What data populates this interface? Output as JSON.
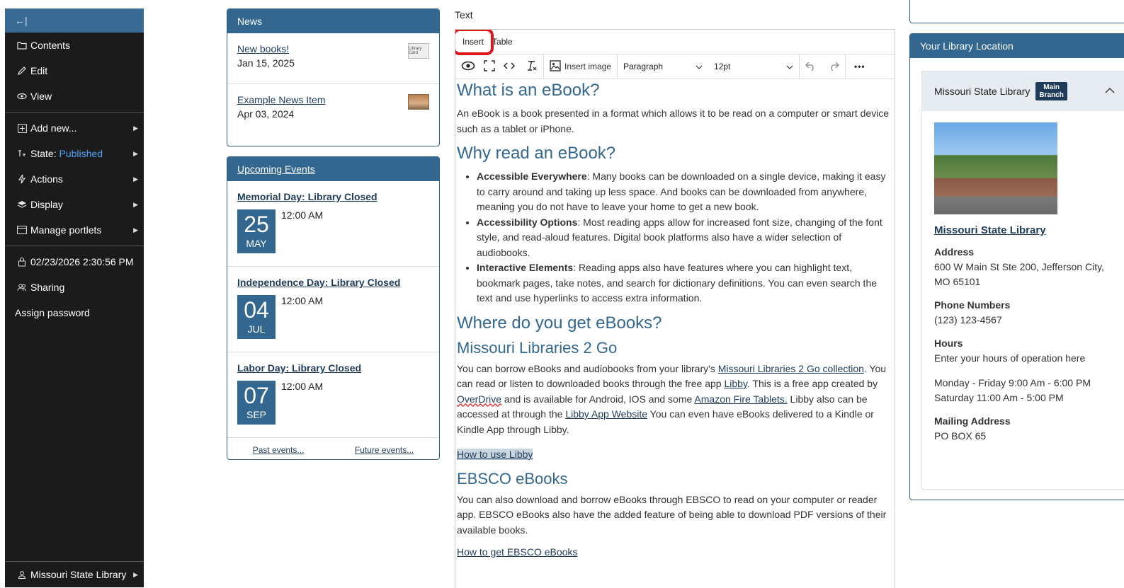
{
  "toolbar": {
    "collapse_icon": "←|",
    "items": [
      {
        "label": "Contents"
      },
      {
        "label": "Edit"
      },
      {
        "label": "View"
      },
      {
        "label": "Add new..."
      },
      {
        "label_prefix": "State:",
        "label_value": "Published"
      },
      {
        "label": "Actions"
      },
      {
        "label": "Display"
      },
      {
        "label": "Manage portlets"
      },
      {
        "label": "02/23/2026 2:30:56 PM"
      },
      {
        "label": "Sharing"
      },
      {
        "label": "Assign password"
      }
    ],
    "user": "Missouri State Library",
    "colors": {
      "accent": "#4ea3ff",
      "bg": "#1b1b1b",
      "header": "#3a6b94"
    }
  },
  "news": {
    "header": "News",
    "items": [
      {
        "title": "New books!",
        "date": "Jan 15, 2025",
        "thumb": "Library Card"
      },
      {
        "title": "Example News Item",
        "date": "Apr 03, 2024"
      }
    ]
  },
  "events": {
    "header": "Upcoming Events",
    "items": [
      {
        "title": "Memorial Day: Library Closed",
        "day": "25",
        "month": "MAY",
        "time": "12:00 AM"
      },
      {
        "title": "Independence Day: Library Closed",
        "day": "04",
        "month": "JUL",
        "time": "12:00 AM"
      },
      {
        "title": "Labor Day: Library Closed",
        "day": "07",
        "month": "SEP",
        "time": "12:00 AM"
      }
    ],
    "past": "Past events...",
    "future": "Future events..."
  },
  "editor": {
    "field_label": "Text",
    "menu": {
      "insert": "Insert",
      "table": "Table"
    },
    "toolbar": {
      "insert_image": "Insert image",
      "block_format": "Paragraph",
      "font_size": "12pt",
      "more": "•••"
    },
    "content": {
      "h1": "What is an eBook?",
      "p1": "An eBook is a book presented in a format which allows it to be read on a computer or smart device such as a tablet or iPhone.",
      "h2": "Why read an eBook?",
      "bullets": [
        {
          "bold": "Accessible Everywhere",
          "text": ": Many books can be downloaded on a single device, making it easy to carry around and taking up less space. And books can be downloaded from anywhere, meaning you do not have to leave your home to get a new book."
        },
        {
          "bold": "Accessibility Options",
          "text": ": Most reading apps allow for increased font size, changing of the font style, and read-aloud features. Digital book platforms also have a wider selection of audiobooks."
        },
        {
          "bold": "Interactive Elements",
          "text": ": Reading apps also have features where you can highlight text, bookmark pages, take notes, and search for dictionary definitions. You can even search the text and use hyperlinks to access extra information."
        }
      ],
      "h3": "Where do you get eBooks?",
      "h4": "Missouri Libraries 2 Go",
      "p2_a": "You can borrow eBooks and audiobooks from your library's ",
      "p2_link1": "Missouri Libraries 2 Go collection",
      "p2_b": ". You can read or listen to downloaded books through the free app ",
      "p2_link2": "Libby",
      "p2_c": ". This is a free app created by ",
      "p2_link3": "OverDrive",
      "p2_d": " and is available for Android, IOS and some ",
      "p2_link4": "Amazon Fire Tablets.",
      "p2_e": " Libby also can be accessed at through the ",
      "p2_link5": "Libby App Website",
      "p2_f": " You can even have eBooks delivered to a Kindle or Kindle App through Libby.",
      "libby_link": "How to use Libby",
      "h5": "EBSCO eBooks",
      "p3": "You can also download and borrow eBooks through EBSCO to read on your computer or reader app. EBSCO eBooks also have the added feature of being able to download PDF versions of their available books.",
      "ebsco_link": "How to get EBSCO eBooks"
    }
  },
  "location": {
    "header": "Your Library Location",
    "card_title": "Missouri State Library",
    "badge_line1": "Main",
    "badge_line2": "Branch",
    "name": "Missouri State Library",
    "address_label": "Address",
    "address": "600 W Main St Ste 200, Jefferson City, MO 65101",
    "phone_label": "Phone Numbers",
    "phone": "(123) 123-4567",
    "hours_label": "Hours",
    "hours_note": "Enter your hours of operation here",
    "hours_1": "Monday - Friday 9:00 Am - 6:00 PM",
    "hours_2": "Saturday 11:00 Am - 5:00 PM",
    "mailing_label": "Mailing Address",
    "mailing": "PO BOX 65"
  }
}
